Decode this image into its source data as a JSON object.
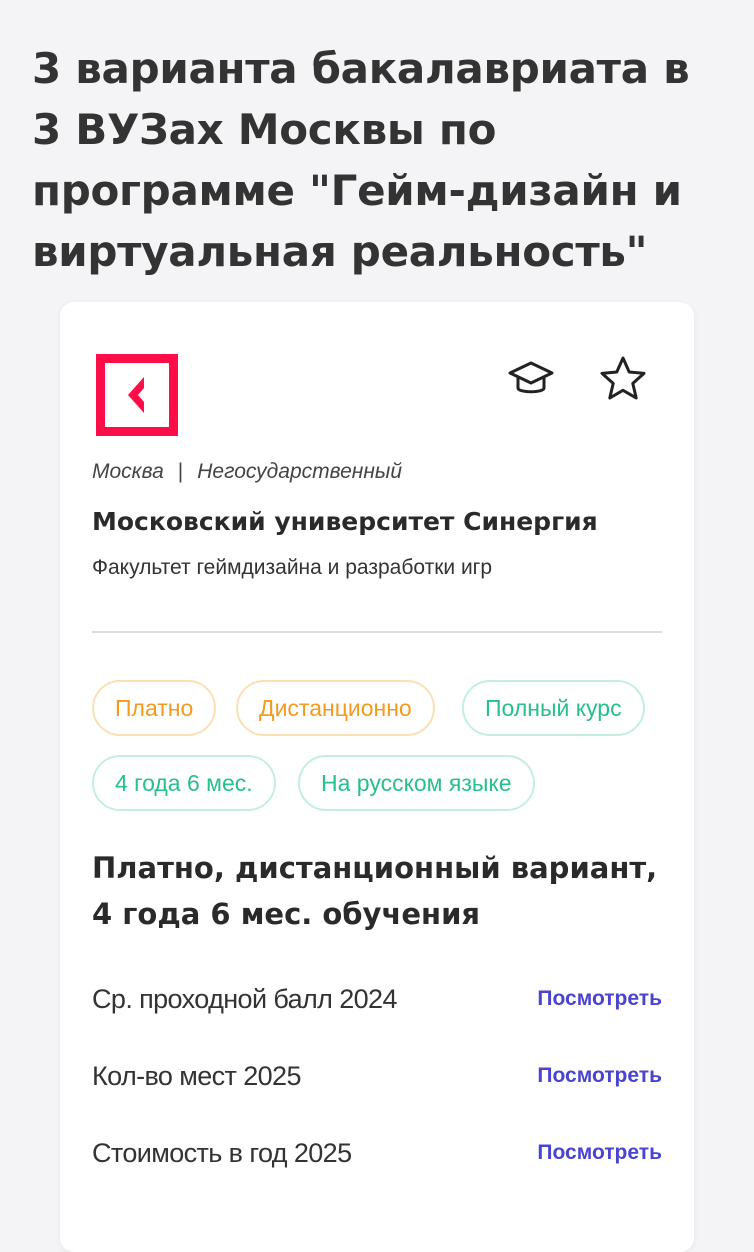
{
  "page": {
    "title": "3 варианта бакалавриата в 3 ВУЗах Москвы по программе \"Гейм-дизайн и виртуальная реальность\""
  },
  "card": {
    "logo_icon": "synergy-logo",
    "actions": [
      {
        "icon": "graduation-cap-icon"
      },
      {
        "icon": "star-icon"
      }
    ],
    "city": "Москва",
    "separator": "|",
    "ownership": "Негосударственный",
    "university": "Московский университет Синергия",
    "faculty": "Факультет геймдизайна и разработки игр",
    "tags": [
      {
        "label": "Платно",
        "color": "orange"
      },
      {
        "label": "Дистанционно",
        "color": "orange"
      },
      {
        "label": "Полный курс",
        "color": "green"
      },
      {
        "label": "4 года 6 мес.",
        "color": "green"
      },
      {
        "label": "На русском языке",
        "color": "green"
      }
    ],
    "offer_title": "Платно, дистанционный вариант, 4 года 6 мес. обучения",
    "stats": [
      {
        "label": "Ср. проходной балл 2024",
        "link": "Посмотреть"
      },
      {
        "label": "Кол-во мест 2025",
        "link": "Посмотреть"
      },
      {
        "label": "Стоимость в год 2025",
        "link": "Посмотреть"
      }
    ]
  },
  "colors": {
    "logo_red": "#ff0d48",
    "tag_orange": "#f39a1f",
    "tag_green": "#27c08b",
    "link": "#4b44d3"
  }
}
